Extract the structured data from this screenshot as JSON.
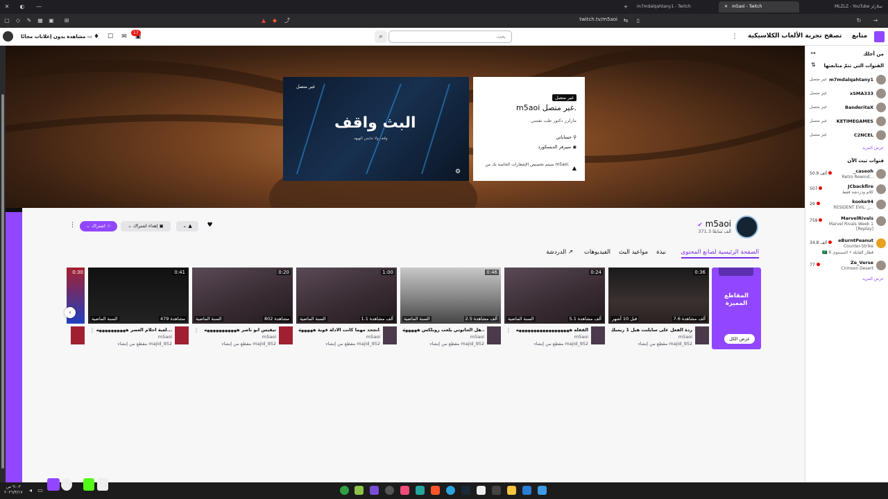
{
  "browser": {
    "tabs": [
      {
        "label": "m7mdalqahtany1 - Twitch"
      },
      {
        "label": "m5aoi - Twitch"
      },
      {
        "label": "MLZLZ - YouTube سلازلز"
      }
    ],
    "url": "twitch.tv/m5aoi"
  },
  "topnav": {
    "links": [
      "متابع",
      "تصفح",
      "تجربة الألعاب الكلاسيكية"
    ],
    "search_placeholder": "بحث",
    "ad_free_label": "مشاهدة بدون إعلانات مجانًا",
    "notif_count": "17"
  },
  "sidebar": {
    "for_you": "من أجلك",
    "followed_header": "القنوات التي تتمّ متابعتها",
    "offline_label": "غير متصل",
    "followed": [
      {
        "name": "m7mdalqahtany1",
        "status": "غير متصل"
      },
      {
        "name": "xSMA333",
        "status": "غير متصل"
      },
      {
        "name": "BanderitaX",
        "status": "غير متصل"
      },
      {
        "name": "KETIMEGAMES",
        "status": "غير متصل"
      },
      {
        "name": "C2NCEL",
        "status": "غير متصل"
      }
    ],
    "show_more_1": "عرض المزيد",
    "live_header": "قنوات تبث الآن",
    "live": [
      {
        "name": "_caseoh",
        "sub": "Retro Rewind...",
        "viewers": "50.9 ألف"
      },
      {
        "name": "JCbackfire",
        "sub": "كلام ودردشة فقط",
        "viewers": "507"
      },
      {
        "name": "kooke94",
        "sub": "RESIDENT EVIL: ر...",
        "viewers": "29"
      },
      {
        "name": "MarvelRivals",
        "sub": "Marvel Rivals Week 1 [Replay]",
        "viewers": "759"
      },
      {
        "name": "eBurntPeanut",
        "sub": "Counter-Strike",
        "viewers": "34.8 ألف"
      },
      {
        "name": "🇸🇦 قطار القايلة • المستوى 6",
        "sub": "",
        "viewers": ""
      },
      {
        "name": "Ze_Verse",
        "sub": "Crimson Desert",
        "viewers": "77"
      }
    ],
    "show_more_2": "عرض المزيد"
  },
  "offline": {
    "badge": "غير متصل",
    "title": "m5aoi غير متصل.",
    "bio": "مازلزز دكتور طب نفسي",
    "links": [
      "حساباتي",
      "سيرفر الديسكورد"
    ],
    "notify_text": "سيتم تخصيص الإشعارات الخاصة بك من m5aoi.",
    "thumb_label": "غير متصل",
    "thumb_title": "البث واقف",
    "thumb_sub": "وقف ولا جابس الهيهه"
  },
  "channel": {
    "name": "m5aoi",
    "followers": "371.3 ألف متابعًا",
    "subscribe": "اشتراك",
    "gift": "إهداء اشتراك",
    "tabs": [
      "الصفحة الرئيسية لصانع المحتوى",
      "نبذة",
      "مواعيد البث",
      "الفيديوهات",
      "الدردشة"
    ]
  },
  "featured": {
    "title": "المقاطع المميزة",
    "view_all": "عرض الكل"
  },
  "clips": [
    {
      "duration": "0:36",
      "views": "7.6 ألف مشاهدة",
      "date": "قبل 10 أشهر",
      "title": "ردة الفعل على سايلنت هيل 1 ريميك",
      "channel": "m5aoi",
      "creator": "مقطع من إنشاء majid_952"
    },
    {
      "duration": "0:24",
      "views": "5.1 ألف مشاهدة",
      "date": "السنة الماضية",
      "title": "القفله ههههههههههههههههههه",
      "channel": "m5aoi",
      "creator": "مقطع من إنشاء majid_952"
    },
    {
      "duration": "0:46",
      "views": "2.5 ألف مشاهدة",
      "date": "السنة الماضية",
      "title": "هل الحانوتي يلعب روبلكس هههههه...",
      "channel": "m5aoi",
      "creator": "مقطع من إنشاء majid_952"
    },
    {
      "duration": "1:00",
      "views": "1.1 ألف مشاهدة",
      "date": "السنة الماضية",
      "title": "انجحد مهما كانت الادلة قوية هههههه...",
      "channel": "m5aoi",
      "creator": "مقطع من إنشاء majid_952"
    },
    {
      "duration": "0:20",
      "views": "802 مشاهدة",
      "date": "السنة الماضية",
      "title": "تيفيس ابو ناصر هههههههههههه",
      "channel": "m5aoi",
      "creator": "مقطع من إنشاء majid_952"
    },
    {
      "duration": "0:41",
      "views": "479 مشاهدة",
      "date": "السنة الماضية",
      "title": "لعبة احلام العصر ههههههههههه...",
      "channel": "m5aoi",
      "creator": "مقطع من إنشاء majid_952"
    },
    {
      "duration": "0:30",
      "views": "",
      "date": "",
      "title": "",
      "channel": "",
      "creator": ""
    }
  ],
  "taskbar": {
    "time": "٩:٠٣ ص",
    "date": "٢٠٢٦/٣/١٧"
  },
  "colors": {
    "twitch_purple": "#9147ff",
    "live_red": "#eb0400"
  }
}
